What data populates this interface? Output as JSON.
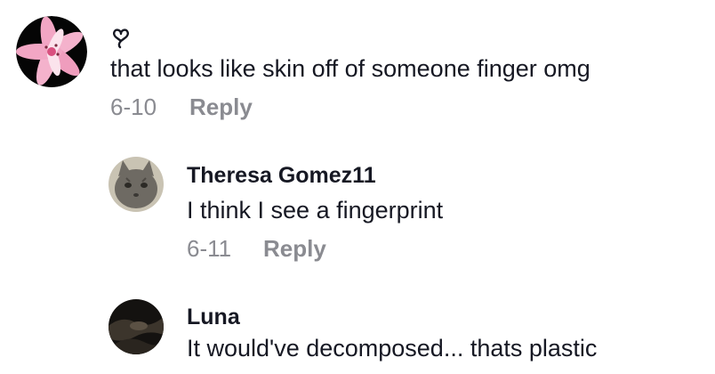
{
  "comments": [
    {
      "username": "",
      "text": "that looks like skin off of someone finger omg",
      "date": "6-10",
      "reply_label": "Reply",
      "avatar_icon": "pink-lily-flower-avatar",
      "name_icon": "heart-outline-icon"
    },
    {
      "username": "Theresa Gomez11",
      "text": "I think I see a fingerprint",
      "date": "6-11",
      "reply_label": "Reply",
      "avatar_icon": "gray-cat-avatar"
    },
    {
      "username": "Luna",
      "text": "It would've decomposed... thats plastic",
      "avatar_icon": "dark-photo-avatar"
    }
  ],
  "colors": {
    "text_primary": "#161823",
    "text_secondary": "#8a8b91",
    "background": "#ffffff"
  }
}
